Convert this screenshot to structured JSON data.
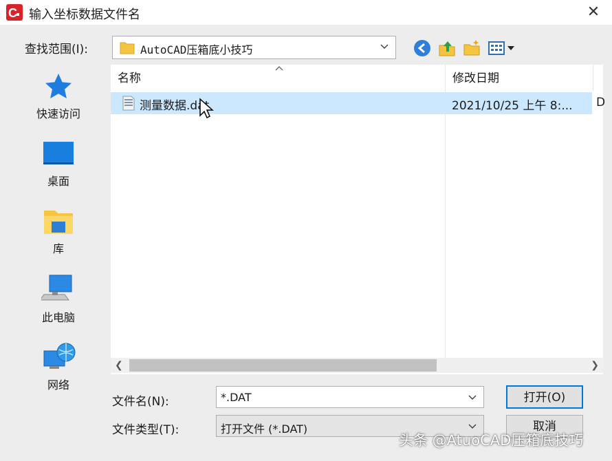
{
  "window": {
    "title": "输入坐标数据文件名"
  },
  "toolbar": {
    "lookin_label": "查找范围(I):",
    "lookin_value": "AutoCAD压箱底小技巧"
  },
  "places": [
    {
      "label": "快速访问",
      "icon": "star-icon"
    },
    {
      "label": "桌面",
      "icon": "desktop-icon"
    },
    {
      "label": "库",
      "icon": "library-icon"
    },
    {
      "label": "此电脑",
      "icon": "computer-icon"
    },
    {
      "label": "网络",
      "icon": "network-icon"
    }
  ],
  "filelist": {
    "columns": [
      "名称",
      "修改日期"
    ],
    "files": [
      {
        "name": "测量数据.dat",
        "modified": "2021/10/25 上午 8:...",
        "extra": "D"
      }
    ]
  },
  "form": {
    "filename_label": "文件名(N):",
    "filename_value": "*.DAT",
    "filetype_label": "文件类型(T):",
    "filetype_value": "打开文件 (*.DAT)",
    "open_label": "打开(O)",
    "cancel_label": "取消"
  },
  "watermark": "头条 @AtuoCAD压箱底技巧",
  "colors": {
    "selection": "#cce8ff",
    "accent": "#0078d7",
    "brand": "#d9232a"
  }
}
